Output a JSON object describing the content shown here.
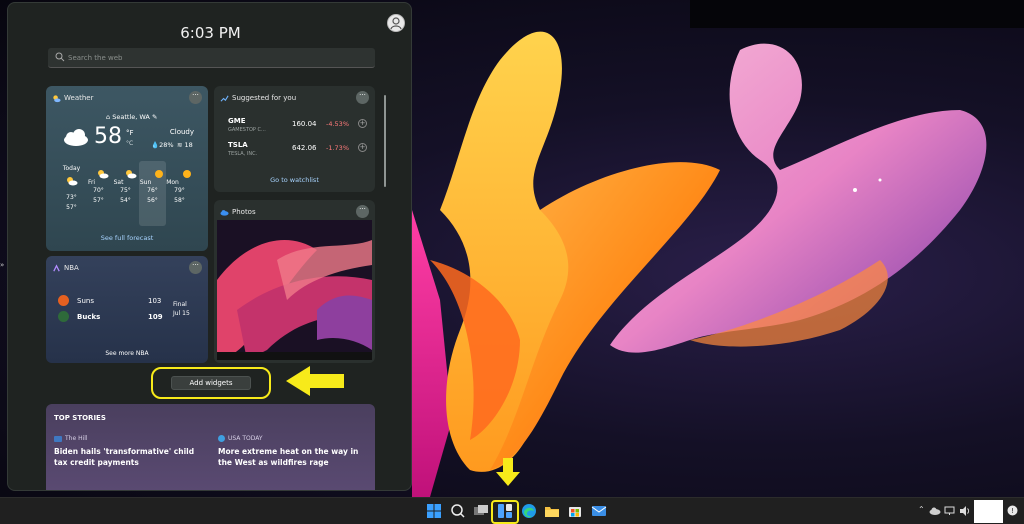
{
  "panel": {
    "time": "6:03 PM",
    "search_placeholder": "Search the web",
    "add_widgets": "Add widgets",
    "scroll_position": 0.0
  },
  "weather": {
    "title": "Weather",
    "location": "Seattle, WA",
    "temp": "58",
    "unit_f": "°F",
    "unit_c": "°C",
    "condition": "Cloudy",
    "precip": "28%",
    "wind": "18",
    "forecast": [
      {
        "day": "Today",
        "hi": "73°",
        "lo": "57°",
        "icon": "partly-cloudy-icon"
      },
      {
        "day": "Fri",
        "hi": "70°",
        "lo": "57°",
        "icon": "partly-cloudy-icon"
      },
      {
        "day": "Sat",
        "hi": "75°",
        "lo": "54°",
        "icon": "partly-cloudy-icon"
      },
      {
        "day": "Sun",
        "hi": "76°",
        "lo": "56°",
        "icon": "sun-icon"
      },
      {
        "day": "Mon",
        "hi": "79°",
        "lo": "58°",
        "icon": "sun-icon"
      }
    ],
    "link": "See full forecast"
  },
  "stocks": {
    "title": "Suggested for you",
    "items": [
      {
        "symbol": "GME",
        "company": "GAMESTOP C...",
        "price": "160.04",
        "change": "-4.53%"
      },
      {
        "symbol": "TSLA",
        "company": "TESLA, INC.",
        "price": "642.06",
        "change": "-1.73%"
      }
    ],
    "link": "Go to watchlist"
  },
  "photos": {
    "title": "Photos"
  },
  "nba": {
    "title": "NBA",
    "teams": [
      {
        "name": "Suns",
        "score": "103"
      },
      {
        "name": "Bucks",
        "score": "109"
      }
    ],
    "status": "Final",
    "date": "Jul 15",
    "link": "See more NBA"
  },
  "stories": {
    "header": "TOP STORIES",
    "items": [
      {
        "source": "The Hill",
        "headline": "Biden hails 'transformative' child tax credit payments"
      },
      {
        "source": "USA TODAY",
        "headline": "More extreme heat on the way in the West as wildfires rage"
      }
    ]
  },
  "colors": {
    "highlight": "#f7ea1a",
    "stock_negative": "#ff7a7a",
    "link": "#a8d4ff"
  }
}
